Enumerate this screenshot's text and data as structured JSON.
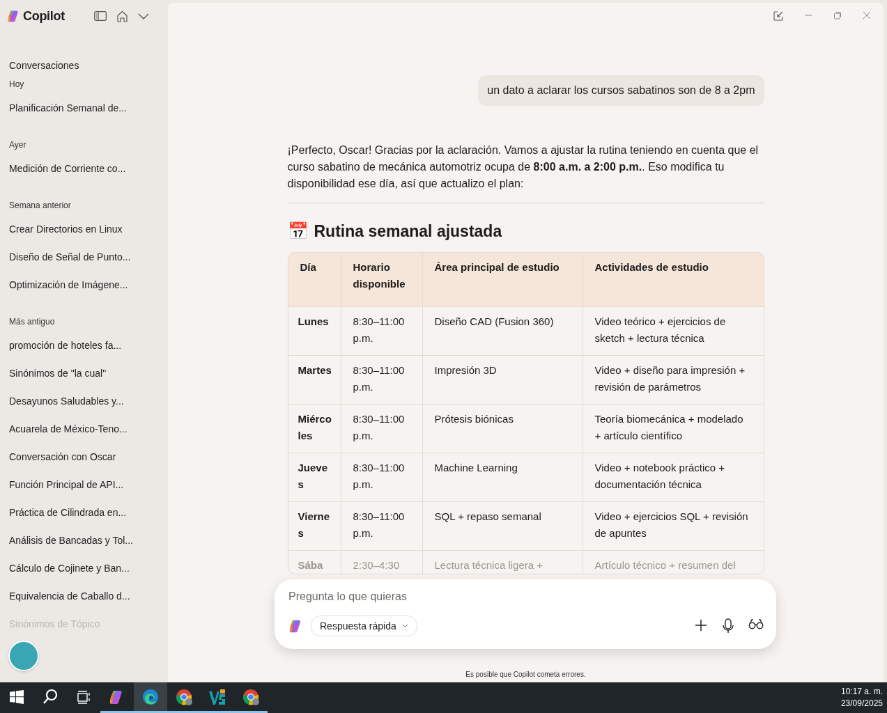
{
  "app": {
    "name": "Copilot"
  },
  "sidebar": {
    "heading": "Conversaciones",
    "groups": [
      {
        "label": "Hoy",
        "items": [
          {
            "title": "Planificación Semanal de...",
            "faded": false
          }
        ]
      },
      {
        "label": "Ayer",
        "items": [
          {
            "title": "Medición de Corriente co...",
            "faded": false
          }
        ]
      },
      {
        "label": "Semana anterior",
        "items": [
          {
            "title": "Crear Directorios en Linux",
            "faded": false
          },
          {
            "title": "Diseño de Señal de Punto...",
            "faded": false
          },
          {
            "title": "Optimización de Imágene...",
            "faded": false
          }
        ]
      },
      {
        "label": "Más antiguo",
        "items": [
          {
            "title": "promoción de hoteles fa...",
            "faded": false
          },
          {
            "title": "Sinónimos de \"la cual\"",
            "faded": false
          },
          {
            "title": "Desayunos Saludables y...",
            "faded": false
          },
          {
            "title": "Acuarela de México-Teno...",
            "faded": false
          },
          {
            "title": "Conversación con Oscar",
            "faded": false
          },
          {
            "title": "Función Principal de API...",
            "faded": false
          },
          {
            "title": "Práctica de Cilindrada en...",
            "faded": false
          },
          {
            "title": "Análisis de Bancadas y Tol...",
            "faded": false
          },
          {
            "title": "Cálculo de Cojinete y Ban...",
            "faded": false
          },
          {
            "title": "Equivalencia de Caballo d...",
            "faded": false
          },
          {
            "title": "Sinónimos de Tópico",
            "faded": true
          }
        ]
      }
    ]
  },
  "chat": {
    "user_message": "un dato a aclarar los cursos sabatinos son de 8 a 2pm",
    "reply": "¡Perfecto, Oscar! Gracias por la aclaración. Vamos a ajustar la rutina teniendo en cuenta que el curso sabatino de mecánica automotriz ocupa de **8:00 a.m. a 2:00 p.m.**. Eso modifica tu disponibilidad ese día, así que actualizo el plan:",
    "section_title": "Rutina semanal ajustada",
    "section_emoji": "📅",
    "table": {
      "columns": [
        "Día",
        "Horario disponible",
        "Área principal de estudio",
        "Actividades de estudio"
      ],
      "rows": [
        {
          "cells": [
            "Lunes",
            "8:30–11:00 p.m.",
            "Diseño CAD (Fusion 360)",
            "Video teórico + ejercicios de sketch + lectura técnica"
          ],
          "faded": false
        },
        {
          "cells": [
            "Martes",
            "8:30–11:00 p.m.",
            "Impresión 3D",
            "Video + diseño para impresión + revisión de parámetros"
          ],
          "faded": false
        },
        {
          "cells": [
            "Miércoles",
            "8:30–11:00 p.m.",
            "Prótesis biónicas",
            "Teoría biomecánica + modelado + artículo científico"
          ],
          "faded": false
        },
        {
          "cells": [
            "Jueves",
            "8:30–11:00 p.m.",
            "Machine Learning",
            "Video + notebook práctico + documentación técnica"
          ],
          "faded": false
        },
        {
          "cells": [
            "Viernes",
            "8:30–11:00 p.m.",
            "SQL + repaso semanal",
            "Video + ejercicios SQL + revisión de apuntes"
          ],
          "faded": false
        },
        {
          "cells": [
            "Sába",
            "2:30–4:30",
            "Lectura técnica ligera +",
            "Artículo técnico + resumen del"
          ],
          "faded": true
        }
      ]
    }
  },
  "composer": {
    "placeholder": "Pregunta lo que quieras",
    "mode": "Respuesta rápida"
  },
  "disclaimer": "Es posible que Copilot cometa errores.",
  "taskbar": {
    "items": [
      {
        "kind": "start",
        "running": false,
        "selected": false
      },
      {
        "kind": "search",
        "running": false,
        "selected": false
      },
      {
        "kind": "taskview",
        "running": false,
        "selected": false
      },
      {
        "kind": "copilot",
        "running": true,
        "selected": false
      },
      {
        "kind": "edge",
        "running": true,
        "selected": true
      },
      {
        "kind": "chrome",
        "running": true,
        "selected": false
      },
      {
        "kind": "vs",
        "running": true,
        "selected": false
      },
      {
        "kind": "chrome",
        "running": true,
        "selected": false
      }
    ],
    "time": "10:17 a. m.",
    "date": "23/09/2025"
  }
}
